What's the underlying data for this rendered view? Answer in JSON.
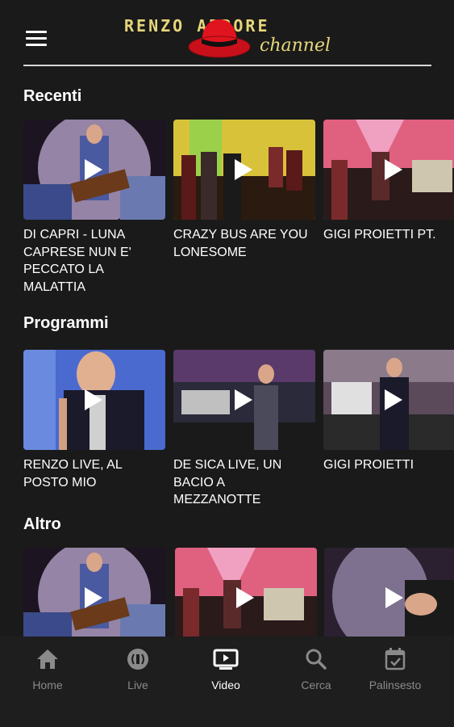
{
  "header": {
    "logo_top": "RENZO ARBORE",
    "logo_sub": "channel"
  },
  "sections": [
    {
      "title": "Recenti",
      "items": [
        {
          "title": "DI CAPRI - LUNA CAPRESE NUN E' PECCATO LA MALATTIA"
        },
        {
          "title": "CRAZY BUS ARE YOU LONESOME"
        },
        {
          "title": "GIGI PROIETTI PT."
        }
      ]
    },
    {
      "title": "Programmi",
      "items": [
        {
          "title": "RENZO LIVE, AL POSTO MIO"
        },
        {
          "title": "DE SICA LIVE, UN BACIO A MEZZANOTTE"
        },
        {
          "title": "GIGI PROIETTI"
        }
      ]
    },
    {
      "title": "Altro",
      "items": [
        {
          "title": ""
        },
        {
          "title": ""
        },
        {
          "title": ""
        }
      ]
    }
  ],
  "nav": {
    "items": [
      {
        "label": "Home",
        "icon": "home-icon"
      },
      {
        "label": "Live",
        "icon": "live-icon"
      },
      {
        "label": "Video",
        "icon": "video-icon",
        "active": true
      },
      {
        "label": "Cerca",
        "icon": "search-icon"
      },
      {
        "label": "Palinsesto",
        "icon": "calendar-icon"
      }
    ]
  },
  "colors": {
    "background": "#1a1a1a",
    "logo": "#e6d77a",
    "hat": "#e0141e",
    "nav_inactive": "#8a8a8a",
    "nav_active": "#ffffff"
  }
}
